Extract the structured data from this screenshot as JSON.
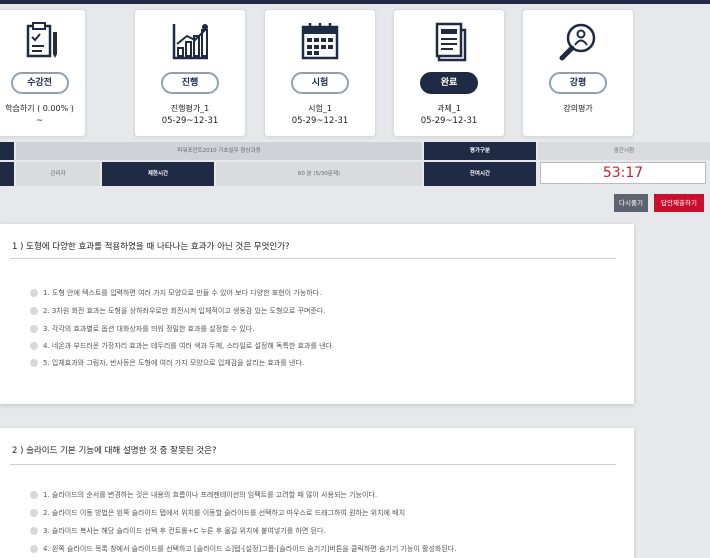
{
  "steps": [
    {
      "pill": "수강전",
      "name": "학습하기 ( 0.00% )",
      "date": "~",
      "state": "outline"
    },
    {
      "pill": "진행",
      "name": "진행평가_1",
      "date": "05-29~12-31",
      "state": "outline"
    },
    {
      "pill": "시험",
      "name": "시험_1",
      "date": "05-29~12-31",
      "state": "outline"
    },
    {
      "pill": "완료",
      "name": "과제_1",
      "date": "05-29~12-31",
      "state": "done"
    },
    {
      "pill": "강평",
      "name": "강의평가",
      "date": "",
      "state": "outline"
    }
  ],
  "info": {
    "course_name": "파워포인트2010 기초실무 향상과정",
    "eval_type_label": "평가구분",
    "eval_type_value": "중간시험",
    "admin_label": "관리자",
    "time_limit_label": "제한시간",
    "time_limit_value": "60 분 (5/30문제)",
    "remaining_label": "잔여시간",
    "remaining_value": "53:17"
  },
  "buttons": {
    "retry": "다시풀기",
    "submit": "답안제출하기"
  },
  "questions": [
    {
      "title": "1 ) 도형에 다양한 효과를 적용하였을 때 나타나는 효과가 아닌 것은 무엇인가?",
      "options": [
        "1.  도형 안에 텍스트를 입력하면 여러 가지 모양으로 만들 수 있어 보다 다양한 표현이 가능하다.",
        "2.  3차원 회전 효과는 도형을 상하좌우로만 회전시켜 입체적이고 생동감 있는 도형으로 꾸며준다.",
        "3.  각각의 효과별로 옵션 대화상자를 띄워 정밀한 효과를 설정할 수 있다.",
        "4.  네온과 부드러운 가장자리 효과는 테두리를 여러 색과 두께, 스타일로 설정해 독특한 효과를 낸다.",
        "5.  입체효과와 그림자, 반사등은 도형에 여러 가지 모양으로 입체감을 살리는 효과를 낸다."
      ]
    },
    {
      "title": "2 ) 슬라이드 기본 기능에 대해 설명한 것 중 잘못된 것은?",
      "options": [
        "1.  슬라이드의 순서를 변경하는 것은 내용의 흐름이나 프레젠테이션의 임팩트를 고려할 때 많이 사용되는 기능이다.",
        "2.  슬라이드 이동 방법은 왼쪽 슬라이드 탭에서 위치를 이동할 슬라이드를 선택하고 마우스로 드래그하여 원하는 위치에 배치",
        "3.  슬라이드 복사는 해당 슬라이드 선택 후 컨트롤+C 누른 후 옮길 위치에 붙여넣기를 하면 된다.",
        "4.  왼쪽 슬라이드 목록 창에서 슬라이드를 선택하고 [슬라이드 쇼]탭-[설정]그룹-[슬라이드 숨기기]버튼을 클릭하면 숨기기 기능이 활성화된다."
      ]
    }
  ]
}
